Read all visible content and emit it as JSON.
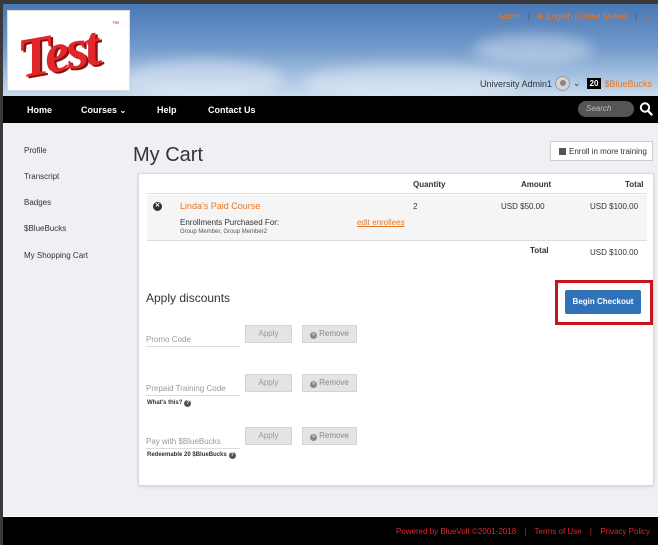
{
  "header": {
    "logo_text": "Test",
    "logo_tm": "™",
    "top_links": {
      "admin": "Admin",
      "language": "English (United States)",
      "cart_icon": "cart-icon"
    },
    "user": {
      "name": "University Admin1",
      "bluebucks_count": "20",
      "bluebucks_label": "$BlueBucks"
    }
  },
  "nav": {
    "items": [
      "Home",
      "Courses",
      "Help",
      "Contact Us"
    ],
    "courses_chevron": "chevron-down-icon",
    "search_placeholder": "Search"
  },
  "sidebar": {
    "items": [
      "Profile",
      "Transcript",
      "Badges",
      "$BlueBucks",
      "My Shopping Cart"
    ]
  },
  "main": {
    "title": "My Cart",
    "enroll_more_label": "Enroll in more training",
    "table": {
      "headers": {
        "quantity": "Quantity",
        "amount": "Amount",
        "total": "Total"
      },
      "rows": [
        {
          "course": "Linda's Paid Course",
          "enrollments_label": "Enrollments Purchased For:",
          "enrollees": "Group Member, Group Member2",
          "edit_link": "edit enrollees",
          "quantity": "2",
          "amount": "USD $50.00",
          "total": "USD $100.00"
        }
      ],
      "total_label": "Total",
      "grand_total": "USD $100.00"
    },
    "discounts": {
      "title": "Apply discounts",
      "checkout_label": "Begin Checkout",
      "highlight_color": "#c4161c",
      "fields": [
        {
          "placeholder": "Promo Code",
          "apply": "Apply",
          "remove": "Remove",
          "note": ""
        },
        {
          "placeholder": "Prepaid Training Code",
          "apply": "Apply",
          "remove": "Remove",
          "note": "What's this?"
        },
        {
          "placeholder": "Pay with $BlueBucks",
          "apply": "Apply",
          "remove": "Remove",
          "note": "Redeemable 20 $BlueBucks"
        }
      ]
    }
  },
  "footer": {
    "powered_by": "Powered by BlueVolt ©2001-2018",
    "terms": "Terms of Use",
    "privacy": "Privacy Policy"
  },
  "colors": {
    "accent_orange": "#e87722",
    "checkout_blue": "#2f72b8",
    "nav_black": "#000000",
    "logo_red": "#e3262a"
  }
}
